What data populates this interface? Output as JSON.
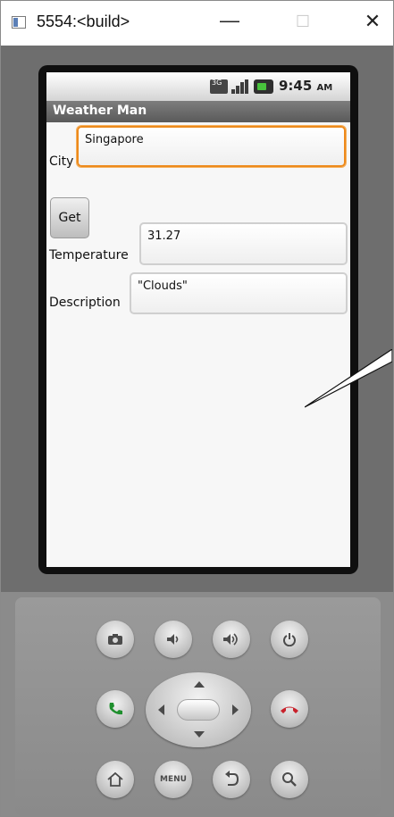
{
  "window": {
    "title": "5554:<build>",
    "minimize_glyph": "—",
    "maximize_glyph": "☐",
    "close_glyph": "✕"
  },
  "status_bar": {
    "network": "3G",
    "time": "9:45",
    "ampm": "AM",
    "icons": [
      "network-3g-icon",
      "signal-icon",
      "battery-icon"
    ]
  },
  "app": {
    "title": "Weather Man",
    "city_label": "City",
    "city_value": "Singapore",
    "get_button": "Get",
    "temperature_label": "Temperature",
    "temperature_value": "31.27",
    "description_label": "Description",
    "description_value": "\"Clouds\""
  },
  "keypad": {
    "buttons": [
      "camera-icon",
      "volume-down-icon",
      "volume-up-icon",
      "power-icon",
      "call-icon",
      "end-call-icon",
      "home-icon",
      "menu-button",
      "back-icon",
      "search-icon"
    ],
    "menu_label": "MENU"
  },
  "colors": {
    "focus_border": "#ed8a1c",
    "call_green": "#1f8f2e",
    "end_call_red": "#c8202a",
    "battery_green": "#48c23c"
  }
}
